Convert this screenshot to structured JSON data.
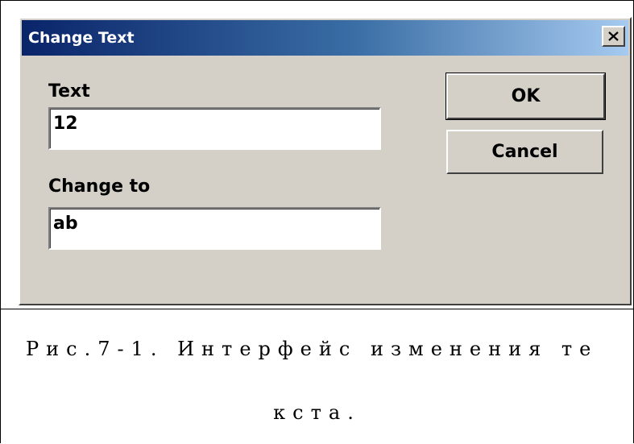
{
  "dialog": {
    "title": "Change Text",
    "close_label": "close",
    "text_label": "Text",
    "text_value": "12",
    "change_to_label": "Change to",
    "change_to_value": "ab",
    "ok_label": "OK",
    "cancel_label": "Cancel"
  },
  "caption": {
    "line1": "Рис.7-1. Интерфейс изменения те",
    "line2": "кста."
  },
  "colors": {
    "window_bg": "#d4d0c8",
    "titlebar_start": "#0a246a",
    "titlebar_end": "#a6caf0",
    "title_text": "#ffffff"
  },
  "icons": {
    "close": "close-icon"
  }
}
